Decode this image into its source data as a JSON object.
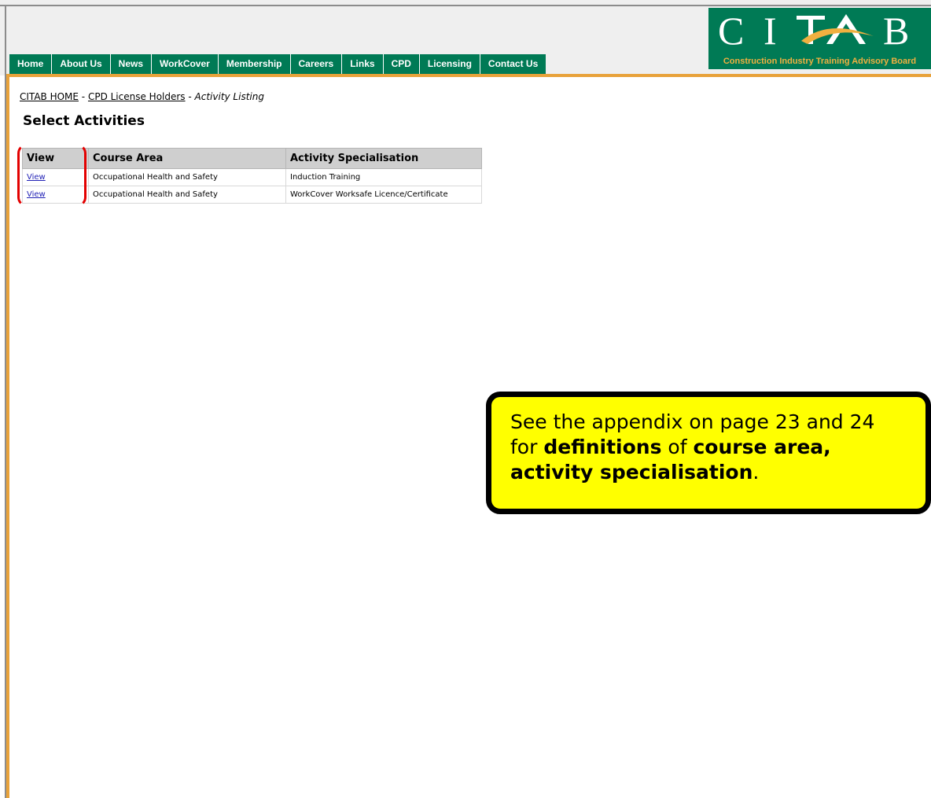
{
  "header": {
    "nav": [
      "Home",
      "About Us",
      "News",
      "WorkCover",
      "Membership",
      "Careers",
      "Links",
      "CPD",
      "Licensing",
      "Contact Us"
    ],
    "logo": {
      "letters": "CITAB",
      "subtitle": "Construction Industry Training Advisory Board"
    }
  },
  "breadcrumb": {
    "home": "CITAB HOME",
    "sep1": " - ",
    "section": "CPD License Holders",
    "sep2": " - ",
    "current": "Activity Listing"
  },
  "page_title": "Select Activities",
  "table": {
    "headers": [
      "View",
      "Course Area",
      "Activity Specialisation"
    ],
    "rows": [
      {
        "view": "View",
        "course_area": "Occupational Health and Safety",
        "specialisation": "Induction Training"
      },
      {
        "view": "View",
        "course_area": "Occupational Health and Safety",
        "specialisation": "WorkCover Worksafe Licence/Certificate"
      }
    ]
  },
  "callout": {
    "part1": "See the appendix on page 23 and 24 for ",
    "bold1": "definitions",
    "part2": " of ",
    "bold2": "course area, activity specialisation",
    "part3": "."
  },
  "colors": {
    "nav_green": "#007a55",
    "accent_orange": "#e8a23a",
    "callout_yellow": "#ffff00",
    "highlight_red": "#e30000"
  }
}
